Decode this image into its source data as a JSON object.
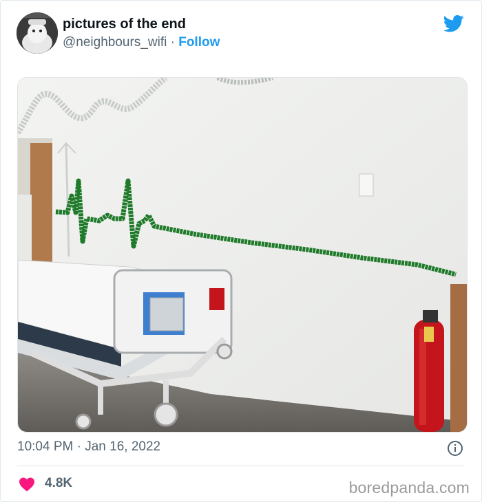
{
  "tweet": {
    "display_name": "pictures of the end",
    "handle": "@neighbours_wifi",
    "separator": "·",
    "follow_label": "Follow",
    "timestamp": "10:04 PM · Jan 16, 2022",
    "like_count": "4.8K"
  },
  "icons": {
    "brand": "twitter-bird-icon",
    "info": "info-icon",
    "like": "heart-icon"
  },
  "colors": {
    "follow": "#1d9bf0",
    "twitter_blue": "#1d9bf0",
    "heart": "#f91880",
    "tinsel_green": "#1f7a2a",
    "extinguisher_red": "#c4151c"
  },
  "watermark": "boredpanda.com"
}
